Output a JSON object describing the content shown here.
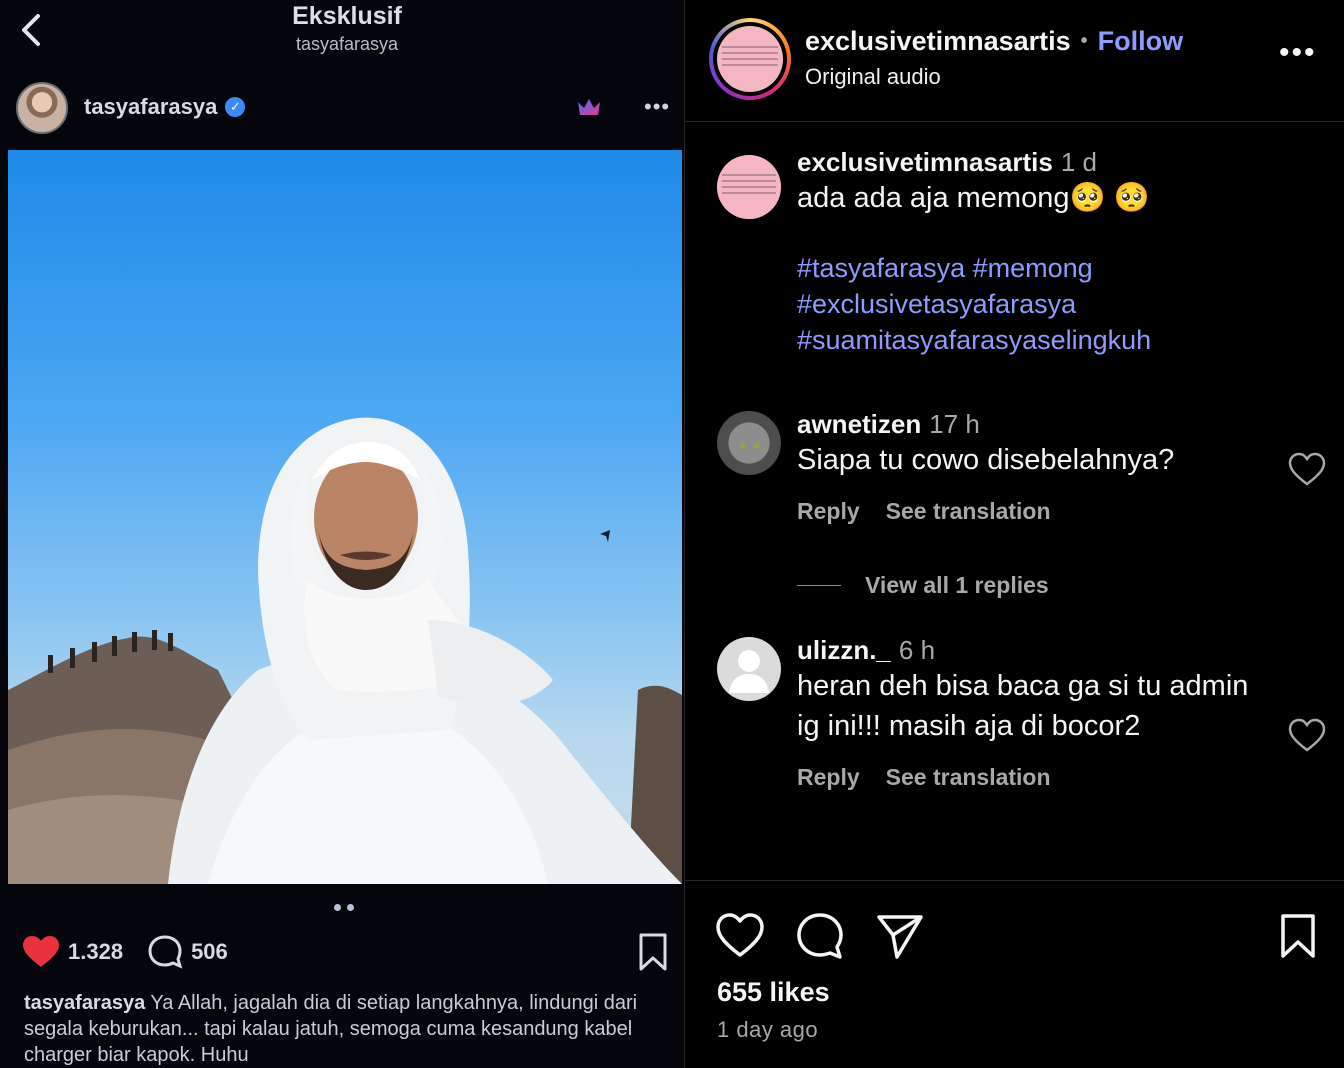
{
  "left_post": {
    "title": "Eksklusif",
    "subtitle": "tasyafarasya",
    "username": "tasyafarasya",
    "likes": "1.328",
    "comments": "506",
    "caption_user": "tasyafarasya",
    "caption_text": " Ya Allah, jagalah dia di setiap langkahnya, lindungi dari segala keburukan... tapi kalau jatuh, semoga cuma kesandung kabel charger biar kapok. Huhu",
    "carousel_index": 2,
    "carousel_count": 2
  },
  "post": {
    "username": "exclusivetimnasartis",
    "follow_label": "Follow",
    "audio": "Original audio",
    "separator": "•"
  },
  "caption": {
    "username": "exclusivetimnasartis",
    "time": "1 d",
    "text": "ada ada aja memong🥺 🥺",
    "hashtags": [
      "#tasyafarasya #memong",
      "#exclusivetasyafarasya",
      "#suamitasyafarasyaselingkuh"
    ]
  },
  "comments": [
    {
      "username": "awnetizen",
      "time": "17 h",
      "text": "Siapa tu cowo disebelahnya?",
      "reply_label": "Reply",
      "translate_label": "See translation",
      "view_replies": "View all 1 replies"
    },
    {
      "username": "ulizzn._",
      "time": "6 h",
      "text": "heran deh bisa baca ga si tu admin ig ini!!! masih aja di bocor2",
      "reply_label": "Reply",
      "translate_label": "See translation"
    }
  ],
  "footer": {
    "likes": "655 likes",
    "time": "1 day ago"
  },
  "colors": {
    "link_blue": "#8e9bff",
    "muted": "#a8a8a8",
    "like_red": "#e8323d"
  }
}
